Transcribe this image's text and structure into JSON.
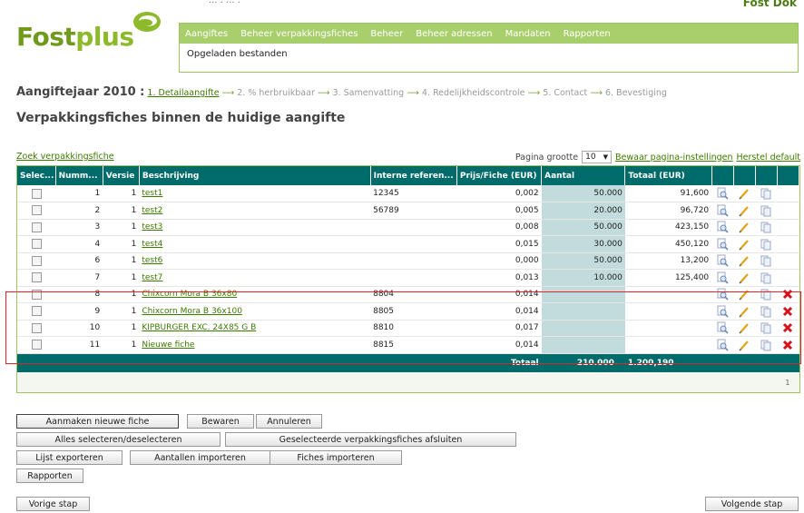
{
  "brand": {
    "logo_text_1": "Fost",
    "logo_text_2": "plus",
    "top_cut_text": "...  .  ...  .",
    "top_right_cut": "Fost Dok"
  },
  "menu": {
    "items": [
      "Aangiftes",
      "Beheer verpakkingsfiches",
      "Beheer",
      "Beheer adressen",
      "Mandaten",
      "Rapporten"
    ],
    "sub_item": "Opgeladen bestanden"
  },
  "steps": {
    "year_label": "Aangiftejaar 2010 :",
    "items": [
      "1. Detailaangifte",
      "2. % herbruikbaar",
      "3. Samenvatting",
      "4. Redelijkheidscontrole",
      "5. Contact",
      "6. Bevestiging"
    ],
    "arrow": "⟶"
  },
  "page_title": "Verpakkingsfiches binnen de huidige aangifte",
  "toolbar": {
    "search_link": "Zoek verpakkingsfiche",
    "page_size_label": "Pagina grootte",
    "page_size_value": "10",
    "save_settings": "Bewaar pagina-instellingen",
    "reset_default": "Herstel default"
  },
  "table": {
    "headers": [
      "Selec...",
      "Numm...",
      "Versie",
      "Beschrijving",
      "Interne referen...",
      "Prijs/Fiche (EUR)",
      "Aantal",
      "Totaal (EUR)"
    ],
    "rows": [
      {
        "nummer": "1",
        "versie": "1",
        "beschrijving": "test1",
        "interne_ref": "12345",
        "prijs": "0,002",
        "aantal": "50.000",
        "totaal": "91,600",
        "delete": false
      },
      {
        "nummer": "2",
        "versie": "1",
        "beschrijving": "test2",
        "interne_ref": "56789",
        "prijs": "0,005",
        "aantal": "20.000",
        "totaal": "96,720",
        "delete": false
      },
      {
        "nummer": "3",
        "versie": "1",
        "beschrijving": "test3",
        "interne_ref": "",
        "prijs": "0,008",
        "aantal": "50.000",
        "totaal": "423,150",
        "delete": false
      },
      {
        "nummer": "4",
        "versie": "1",
        "beschrijving": "test4",
        "interne_ref": "",
        "prijs": "0,015",
        "aantal": "30.000",
        "totaal": "450,120",
        "delete": false
      },
      {
        "nummer": "6",
        "versie": "1",
        "beschrijving": "test6",
        "interne_ref": "",
        "prijs": "0,000",
        "aantal": "50.000",
        "totaal": "13,200",
        "delete": false
      },
      {
        "nummer": "7",
        "versie": "1",
        "beschrijving": "test7",
        "interne_ref": "",
        "prijs": "0,013",
        "aantal": "10.000",
        "totaal": "125,400",
        "delete": false
      },
      {
        "nummer": "8",
        "versie": "1",
        "beschrijving": "Chixcorn Mora B 36x80",
        "interne_ref": "8804",
        "prijs": "0,014",
        "aantal": "",
        "totaal": "",
        "delete": true
      },
      {
        "nummer": "9",
        "versie": "1",
        "beschrijving": "Chixcorn Mora B 36x100",
        "interne_ref": "8805",
        "prijs": "0,014",
        "aantal": "",
        "totaal": "",
        "delete": true
      },
      {
        "nummer": "10",
        "versie": "1",
        "beschrijving": "KIPBURGER EXC. 24X85 G B",
        "interne_ref": "8810",
        "prijs": "0,017",
        "aantal": "",
        "totaal": "",
        "delete": true
      },
      {
        "nummer": "11",
        "versie": "1",
        "beschrijving": "Nieuwe fiche",
        "interne_ref": "8815",
        "prijs": "0,014",
        "aantal": "",
        "totaal": "",
        "delete": true
      }
    ],
    "total_label": "Totaal",
    "total_aantal": "210.000",
    "total_totaal": "1.200,190",
    "pager_page": "1"
  },
  "buttons": {
    "new_fiche": "Aanmaken nieuwe fiche",
    "save": "Bewaren",
    "cancel": "Annuleren",
    "select_all": "Alles selecteren/deselecteren",
    "close_selected": "Geselecteerde verpakkingsfiches afsluiten",
    "export": "Lijst exporteren",
    "import_qty": "Aantallen importeren",
    "import_fiches": "Fiches importeren",
    "reports": "Rapporten",
    "prev": "Vorige stap",
    "next": "Volgende stap"
  },
  "colors": {
    "brand_green": "#8cba2b",
    "header_teal": "#006b6b",
    "highlight_red": "#e0242a"
  }
}
